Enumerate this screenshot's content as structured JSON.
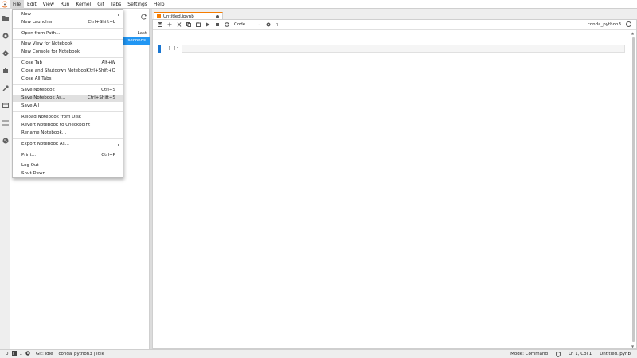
{
  "menubar": {
    "items": [
      "File",
      "Edit",
      "View",
      "Run",
      "Kernel",
      "Git",
      "Tabs",
      "Settings",
      "Help"
    ],
    "active": "File"
  },
  "activity_bar": {
    "icons": [
      "folder-icon",
      "running-icon",
      "git-icon",
      "extension-icon",
      "wrench-icon",
      "window-icon",
      "list-icon",
      "palette-icon"
    ]
  },
  "file_browser": {
    "column_header": "Last Modified",
    "row_modified": "seconds ago"
  },
  "tab": {
    "title": "Untitled.ipynb"
  },
  "toolbar": {
    "cell_type": "Code",
    "kernel": "conda_python3"
  },
  "cell": {
    "prompt": "[ ]:"
  },
  "file_menu": {
    "new": "New",
    "new_launcher": "New Launcher",
    "new_launcher_shortcut": "Ctrl+Shift+L",
    "open_from_path": "Open from Path…",
    "new_view": "New View for Notebook",
    "new_console": "New Console for Notebook",
    "close_tab": "Close Tab",
    "close_tab_shortcut": "Alt+W",
    "close_shutdown": "Close and Shutdown Notebook",
    "close_shutdown_shortcut": "Ctrl+Shift+Q",
    "close_all": "Close All Tabs",
    "save": "Save Notebook",
    "save_shortcut": "Ctrl+S",
    "save_as": "Save Notebook As…",
    "save_as_shortcut": "Ctrl+Shift+S",
    "save_all": "Save All",
    "reload": "Reload Notebook from Disk",
    "revert": "Revert Notebook to Checkpoint",
    "rename": "Rename Notebook…",
    "export": "Export Notebook As…",
    "print": "Print…",
    "print_shortcut": "Ctrl+P",
    "logout": "Log Out",
    "shutdown": "Shut Down"
  },
  "statusbar": {
    "terminals": "0",
    "kernels": "1",
    "git": "Git: idle",
    "kernel_status": "conda_python3 | Idle",
    "mode": "Mode: Command",
    "cursor": "Ln 1, Col 1",
    "filename": "Untitled.ipynb"
  },
  "colors": {
    "accent": "#2196f3",
    "tab_accent": "#f57c00",
    "logo": "#f37726"
  }
}
